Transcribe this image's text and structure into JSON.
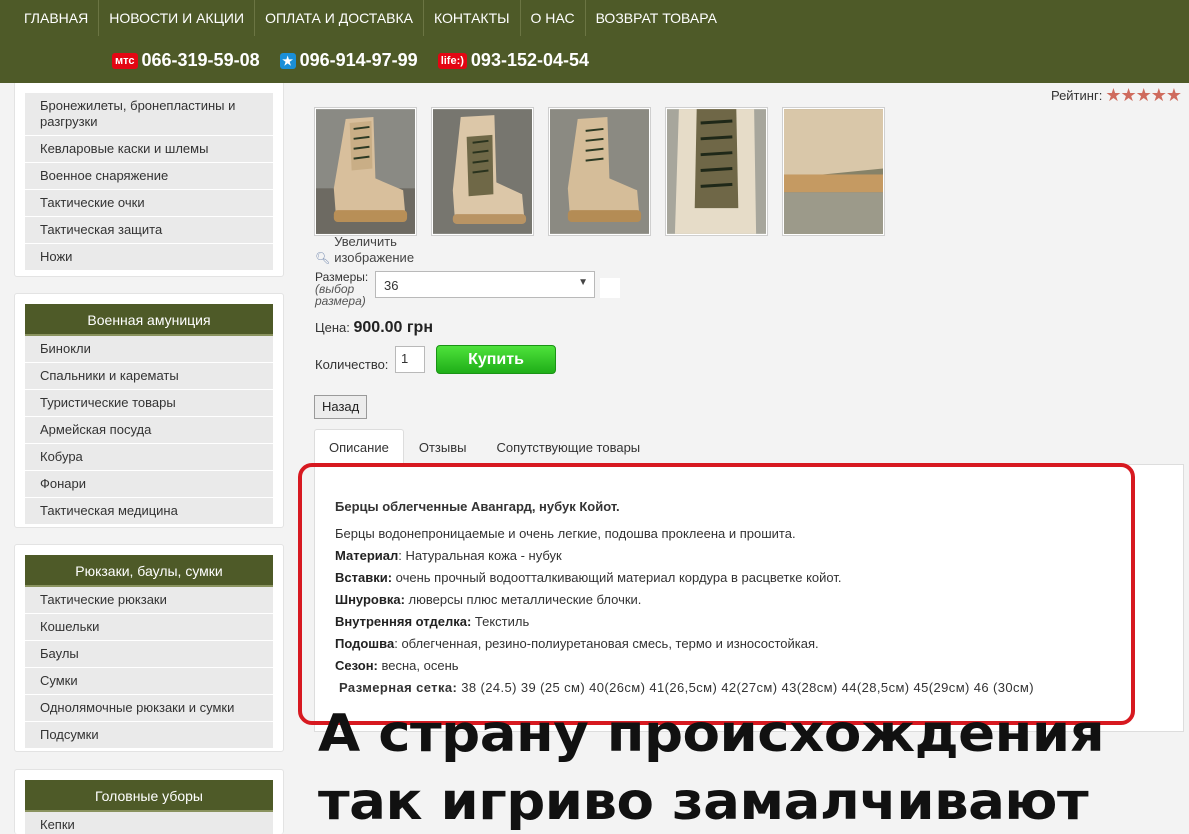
{
  "nav": {
    "items": [
      "ГЛАВНАЯ",
      "НОВОСТИ И АКЦИИ",
      "ОПЛАТА И ДОСТАВКА",
      "КОНТАКТЫ",
      "О НАС",
      "ВОЗВРАТ ТОВАРА"
    ]
  },
  "phones": [
    {
      "operator": "МТС",
      "logo": "мтс",
      "number": "066-319-59-08"
    },
    {
      "operator": "Kyivstar",
      "logo": "★",
      "number": "096-914-97-99"
    },
    {
      "operator": "life:)",
      "logo": "life:)",
      "number": "093-152-04-54"
    }
  ],
  "sidebar": {
    "block1": {
      "items": [
        "Бронежилеты, бронепластины и разгрузки",
        "Кевларовые каски и шлемы",
        "Военное снаряжение",
        "Тактические очки",
        "Тактическая защита",
        "Ножи"
      ]
    },
    "block2": {
      "title": "Военная амуниция",
      "items": [
        "Бинокли",
        "Спальники и карематы",
        "Туристические товары",
        "Армейская посуда",
        "Кобура",
        "Фонари",
        "Тактическая медицина"
      ]
    },
    "block3": {
      "title": "Рюкзаки, баулы, сумки",
      "items": [
        "Тактические рюкзаки",
        "Кошельки",
        "Баулы",
        "Сумки",
        "Однолямочные рюкзаки и сумки",
        "Подсумки"
      ]
    },
    "block4": {
      "title": "Головные уборы",
      "items": [
        "Кепки"
      ]
    }
  },
  "product": {
    "rating_label": "Рейтинг:",
    "rating_stars": 5,
    "zoom_label": "Увеличить изображение",
    "sizes_label": "Размеры:",
    "sizes_hint": "(выбор размера)",
    "size_selected": "36",
    "price_label": "Цена:",
    "price": "900.00 грн",
    "qty_label": "Количество:",
    "qty_value": "1",
    "buy_label": "Купить",
    "back_label": "Назад"
  },
  "tabs": [
    "Описание",
    "Отзывы",
    "Сопутствующие товары"
  ],
  "description": {
    "title": "Берцы облегченные Авангард, нубук Койот.",
    "intro": "Берцы водонепроницаемые и очень легкие, подошва проклеена и прошита.",
    "lines": [
      {
        "label": "Материал",
        "sep": ":",
        "text": " Натуральная кожа - нубук"
      },
      {
        "label": "Вставки:",
        "sep": "",
        "text": " очень прочный водоотталкивающий материал кордура в расцветке койот."
      },
      {
        "label": "Шнуровка:",
        "sep": "",
        "text": " люверсы плюс металлические блочки."
      },
      {
        "label": "Внутренняя отделка:",
        "sep": "",
        "text": " Текстиль"
      },
      {
        "label": "Подошва",
        "sep": ":",
        "text": " облегченная, резино-полиуретановая смесь, термо и износостойкая."
      },
      {
        "label": "Сезон:",
        "sep": "",
        "text": " весна, осень"
      }
    ],
    "size_grid_label": "Размерная сетка:",
    "size_grid": " 38 (24.5) 39 (25 см) 40(26см) 41(26,5см) 42(27см) 43(28см) 44(28,5см) 45(29см) 46 (30см)"
  },
  "caption": "А страну происхождения так игриво замалчивают",
  "colors": {
    "header": "#4e5a28",
    "accent_red": "#d71920",
    "buy_green": "#2bc21f"
  }
}
